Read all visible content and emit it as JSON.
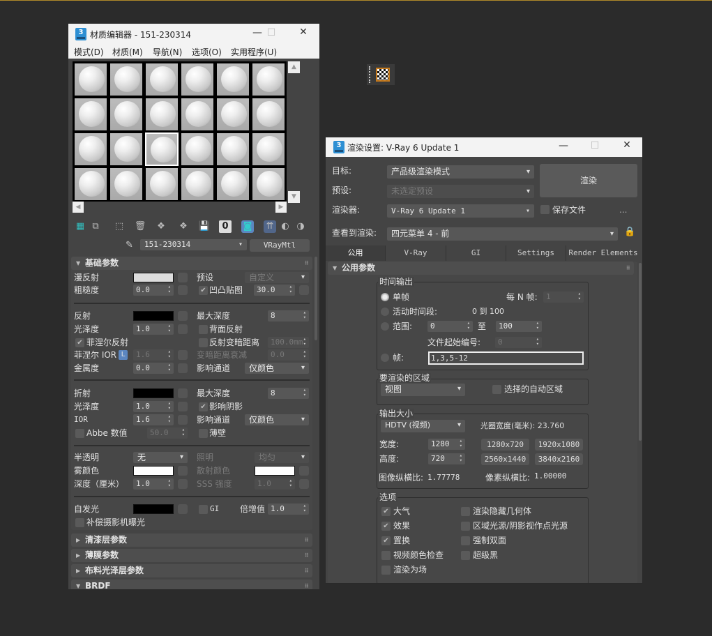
{
  "material_editor": {
    "app_icon": "3",
    "title": "材质编辑器 - 151-230314",
    "menu": [
      "模式(D)",
      "材质(M)",
      "导航(N)",
      "选项(O)",
      "实用程序(U)"
    ],
    "slots": {
      "count": 24,
      "columns": 6,
      "selected": 14
    },
    "material_name": "151-230314",
    "material_type": "VRayMtl",
    "basic_rollout": "基础参数",
    "diffuse": {
      "label": "漫反射",
      "color": "#dcdcdc"
    },
    "preset": {
      "label": "预设",
      "value": "自定义"
    },
    "roughness": {
      "label": "粗糙度",
      "value": "0.0"
    },
    "bump": {
      "label": "凹凸贴图",
      "checked": true,
      "value": "30.0"
    },
    "reflect": {
      "label": "反射",
      "color": "#000000"
    },
    "reflect_max_depth": {
      "label": "最大深度",
      "value": "8"
    },
    "reflect_gloss": {
      "label": "光泽度",
      "value": "1.0"
    },
    "back_reflect": {
      "label": "背面反射",
      "checked": false
    },
    "fresnel": {
      "label": "菲涅尔反射",
      "checked": true
    },
    "dim_distance": {
      "label": "反射变暗距离",
      "checked": false,
      "value": "100.0mm"
    },
    "fresnel_ior": {
      "label": "菲涅尔 IOR",
      "lock": "L",
      "value": "1.6"
    },
    "dim_falloff": {
      "label": "变暗距离衰减",
      "value": "0.0"
    },
    "metalness": {
      "label": "金属度",
      "value": "0.0"
    },
    "reflect_affect": {
      "label": "影响通道",
      "value": "仅颜色"
    },
    "refract": {
      "label": "折射",
      "color": "#000000"
    },
    "refract_max_depth": {
      "label": "最大深度",
      "value": "8"
    },
    "refract_gloss": {
      "label": "光泽度",
      "value": "1.0"
    },
    "affect_shadows": {
      "label": "影响阴影",
      "checked": true
    },
    "ior": {
      "label": "IOR",
      "value": "1.6"
    },
    "refract_affect": {
      "label": "影响通道",
      "value": "仅颜色"
    },
    "abbe": {
      "label": "Abbe 数值",
      "checked": false,
      "value": "50.0"
    },
    "thin_walled": {
      "label": "薄壁",
      "checked": false
    },
    "translucency": {
      "label": "半透明",
      "value": "无"
    },
    "illumination": {
      "label": "照明",
      "value": "均匀"
    },
    "fog_color": {
      "label": "雾颜色",
      "color": "#ffffff"
    },
    "scatter_color": {
      "label": "散射颜色",
      "color": "#ffffff"
    },
    "depth": {
      "label": "深度（厘米）",
      "value": "1.0"
    },
    "sss": {
      "label": "SSS 强度",
      "value": "1.0"
    },
    "self_illum": {
      "label": "自发光",
      "color": "#000000"
    },
    "gi": {
      "label": "GI",
      "checked": false
    },
    "multiplier": {
      "label": "倍增值",
      "value": "1.0"
    },
    "compensate": {
      "label": "补偿摄影机曝光",
      "checked": false
    },
    "rollouts": [
      "清漆层参数",
      "薄膜参数",
      "布料光泽层参数",
      "BRDF"
    ]
  },
  "render_setup": {
    "app_icon": "3",
    "title": "渲染设置: V-Ray 6 Update 1",
    "target": {
      "label": "目标:",
      "value": "产品级渲染模式"
    },
    "preset": {
      "label": "预设:",
      "value": "未选定预设"
    },
    "renderer": {
      "label": "渲染器:",
      "value": "V-Ray 6 Update 1"
    },
    "render_button": "渲染",
    "save_file": {
      "label": "保存文件",
      "checked": false
    },
    "more": "...",
    "view": {
      "label": "查看到渲染:",
      "value": "四元菜单 4 - 前"
    },
    "tabs": [
      "公用",
      "V-Ray",
      "GI",
      "Settings",
      "Render Elements"
    ],
    "active_tab": 0,
    "rollout": "公用参数",
    "time_output": {
      "title": "时间输出",
      "single": "单帧",
      "every_n": {
        "label": "每 N 帧:",
        "value": "1"
      },
      "active_segment": "活动时间段:",
      "active_range": "0 到 100",
      "range": {
        "label": "范围:",
        "from": "0",
        "to_label": "至",
        "to": "100"
      },
      "file_start": {
        "label": "文件起始编号:",
        "value": "0"
      },
      "frames": {
        "label": "帧:",
        "value": "1,3,5-12"
      }
    },
    "area": {
      "title": "要渲染的区域",
      "value": "视图",
      "auto_region": "选择的自动区域"
    },
    "output_size": {
      "title": "输出大小",
      "preset": "HDTV (视频)",
      "aperture": "光圈宽度(毫米): 23.760",
      "width": {
        "label": "宽度:",
        "value": "1280"
      },
      "height": {
        "label": "高度:",
        "value": "720"
      },
      "presets": [
        "1280x720",
        "1920x1080",
        "2560x1440",
        "3840x2160"
      ],
      "image_aspect": {
        "label": "图像纵横比:",
        "value": "1.77778"
      },
      "pixel_aspect": {
        "label": "像素纵横比:",
        "value": "1.00000"
      }
    },
    "options": {
      "title": "选项",
      "col1": [
        {
          "label": "大气",
          "checked": true
        },
        {
          "label": "效果",
          "checked": true
        },
        {
          "label": "置换",
          "checked": true
        },
        {
          "label": "视频颜色检查",
          "checked": false
        },
        {
          "label": "渲染为场",
          "checked": false
        }
      ],
      "col2": [
        {
          "label": "渲染隐藏几何体",
          "checked": false
        },
        {
          "label": "区域光源/阴影视作点光源",
          "checked": false
        },
        {
          "label": "强制双面",
          "checked": false
        },
        {
          "label": "超级黑",
          "checked": false
        }
      ]
    }
  }
}
